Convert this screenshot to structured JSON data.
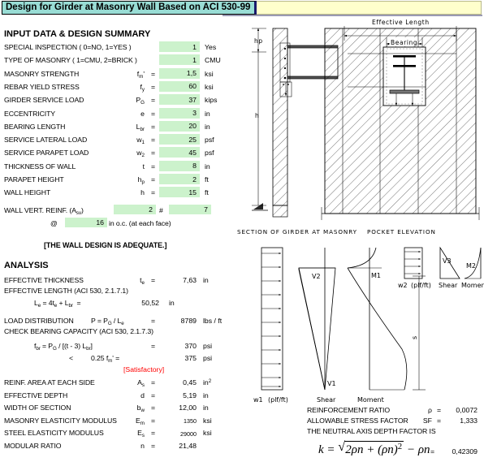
{
  "titlebar": {
    "title": "Design for Girder at Masonry Wall Based on ACI 530-99"
  },
  "input_section": {
    "heading": "INPUT DATA & DESIGN SUMMARY",
    "rows": [
      {
        "label": "SPECIAL INSPECTION ( 0=NO, 1=YES )",
        "symbol": "",
        "eq": "",
        "value": "1",
        "unit": "Yes"
      },
      {
        "label": "TYPE OF MASONRY ( 1=CMU, 2=BRICK )",
        "symbol": "",
        "eq": "",
        "value": "1",
        "unit": "CMU"
      },
      {
        "label": "MASONRY STRENGTH",
        "symbol": "f_m'",
        "eq": "=",
        "value": "1,5",
        "unit": "ksi"
      },
      {
        "label": "REBAR YIELD STRESS",
        "symbol": "f_y",
        "eq": "=",
        "value": "60",
        "unit": "ksi"
      },
      {
        "label": "GIRDER SERVICE LOAD",
        "symbol": "P_G",
        "eq": "=",
        "value": "37",
        "unit": "kips"
      },
      {
        "label": "ECCENTRICITY",
        "symbol": "e",
        "eq": "=",
        "value": "3",
        "unit": "in"
      },
      {
        "label": "BEARING LENGTH",
        "symbol": "L_br",
        "eq": "=",
        "value": "20",
        "unit": "in"
      },
      {
        "label": "SERVICE LATERAL LOAD",
        "symbol": "w_1",
        "eq": "=",
        "value": "25",
        "unit": "psf"
      },
      {
        "label": "SERVICE PARAPET LOAD",
        "symbol": "w_2",
        "eq": "=",
        "value": "45",
        "unit": "psf"
      },
      {
        "label": "THICKNESS OF  WALL",
        "symbol": "t",
        "eq": "=",
        "value": "8",
        "unit": "in"
      },
      {
        "label": "PARAPET HEIGHT",
        "symbol": "h_p",
        "eq": "=",
        "value": "2",
        "unit": "ft"
      },
      {
        "label": "WALL HEIGHT",
        "symbol": "h",
        "eq": "=",
        "value": "15",
        "unit": "ft"
      }
    ],
    "reinf": {
      "label": "WALL VERT. REINF. (A_sv)",
      "count": "2",
      "hash": "#",
      "bar_size": "7",
      "at_symbol": "@",
      "spacing": "16",
      "spacing_note": "in o.c. (at each face)"
    },
    "verdict": "[THE WALL DESIGN IS ADEQUATE.]"
  },
  "analysis_section": {
    "heading": "ANALYSIS",
    "eff_thickness": {
      "label": "EFFECTIVE THICKNESS",
      "symbol": "t_e",
      "eq": "=",
      "value": "7,63",
      "unit": "in"
    },
    "eff_length_header": "EFFECTIVE LENGTH (ACI 530, 2.1.7.1)",
    "eff_length": {
      "formula": "L_e = 4t_e + L_br  =",
      "value": "50,52",
      "unit": "in"
    },
    "load_distribution": {
      "label": "LOAD DISTRIBUTION",
      "formula": "P = P_G / L_e",
      "eq": "=",
      "value": "8789",
      "unit": "lbs / ft"
    },
    "bearing_header": "CHECK BEARING CAPACITY (ACI 530, 2.1.7.3)",
    "bearing_stress": {
      "formula": "f_br = P_G / [(t - 3) L_br]",
      "eq": "=",
      "value": "370",
      "unit": "psi"
    },
    "bearing_allow": {
      "lt": "<",
      "formula": "0.25 f_m' =",
      "value": "375",
      "unit": "psi"
    },
    "bearing_status": "[Satisfactory]",
    "rows": [
      {
        "label": "REINF. AREA AT EACH SIDE",
        "symbol": "A_s",
        "eq": "=",
        "value": "0,45",
        "unit": "in2",
        "small": false
      },
      {
        "label": "EFFECTIVE DEPTH",
        "symbol": "d",
        "eq": "=",
        "value": "5,19",
        "unit": "in",
        "small": false
      },
      {
        "label": "WIDTH OF SECTION",
        "symbol": "b_w",
        "eq": "=",
        "value": "12,00",
        "unit": "in",
        "small": false
      },
      {
        "label": "MASONRY ELASTICITY MODULUS",
        "symbol": "E_m",
        "eq": "=",
        "value": "1350",
        "unit": "ksi",
        "small": true
      },
      {
        "label": "STEEL ELASTICITY MODULUS",
        "symbol": "E_s",
        "eq": "=",
        "value": "29000",
        "unit": "ksi",
        "small": true
      },
      {
        "label": "MODULAR RATIO",
        "symbol": "n",
        "eq": "=",
        "value": "21,48",
        "unit": "",
        "small": false
      }
    ]
  },
  "right_results": {
    "rows": [
      {
        "label": "REINFORCEMENT RATIO",
        "symbol": "ρ",
        "eq": "=",
        "value": "0,0072"
      },
      {
        "label": "ALLOWABLE STRESS FACTOR",
        "symbol": "SF",
        "eq": "=",
        "value": "1,333"
      }
    ],
    "neutral_axis_text": "THE NEUTRAL AXIS DEPTH FACTOR IS",
    "k_formula_label": "k =",
    "k_value_eq": "=",
    "k_value": "0,42309"
  },
  "drawings": {
    "effective_length_label": "Effective Length",
    "bearing_label": "Bearing",
    "hp_label": "hp",
    "h_label": "h",
    "caption_left": "SECTION OF GIRDER AT MASONRY",
    "caption_right": "POCKET ELEVATION",
    "diagrams": {
      "w2_label": "w2  (plf/ft)",
      "w1_label": "w1  (plf/ft)",
      "shear_label": "Shear",
      "moment_label": "Moment",
      "v1_label": "V1",
      "v2_label": "V2",
      "v3_label": "V3",
      "m1_label": "M1",
      "m2_label": "M2",
      "s_label": "s"
    }
  },
  "colors": {
    "title_bg": "#99ddd5",
    "title_yellow": "#ffffcc",
    "input_green": "#ccf2cc",
    "status_red": "#ff0000"
  }
}
